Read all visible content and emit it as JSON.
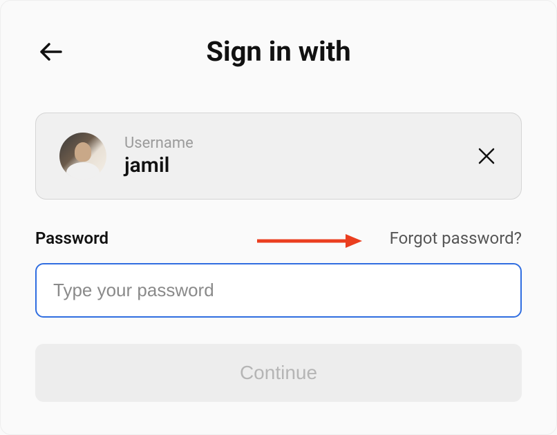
{
  "header": {
    "title": "Sign in with"
  },
  "username_card": {
    "label": "Username",
    "value": "jamil"
  },
  "password": {
    "label": "Password",
    "forgot_label": "Forgot password?",
    "placeholder": "Type your password",
    "value": ""
  },
  "continue_label": "Continue",
  "colors": {
    "input_focus_border": "#2f6de0",
    "arrow": "#ea3e1f"
  }
}
